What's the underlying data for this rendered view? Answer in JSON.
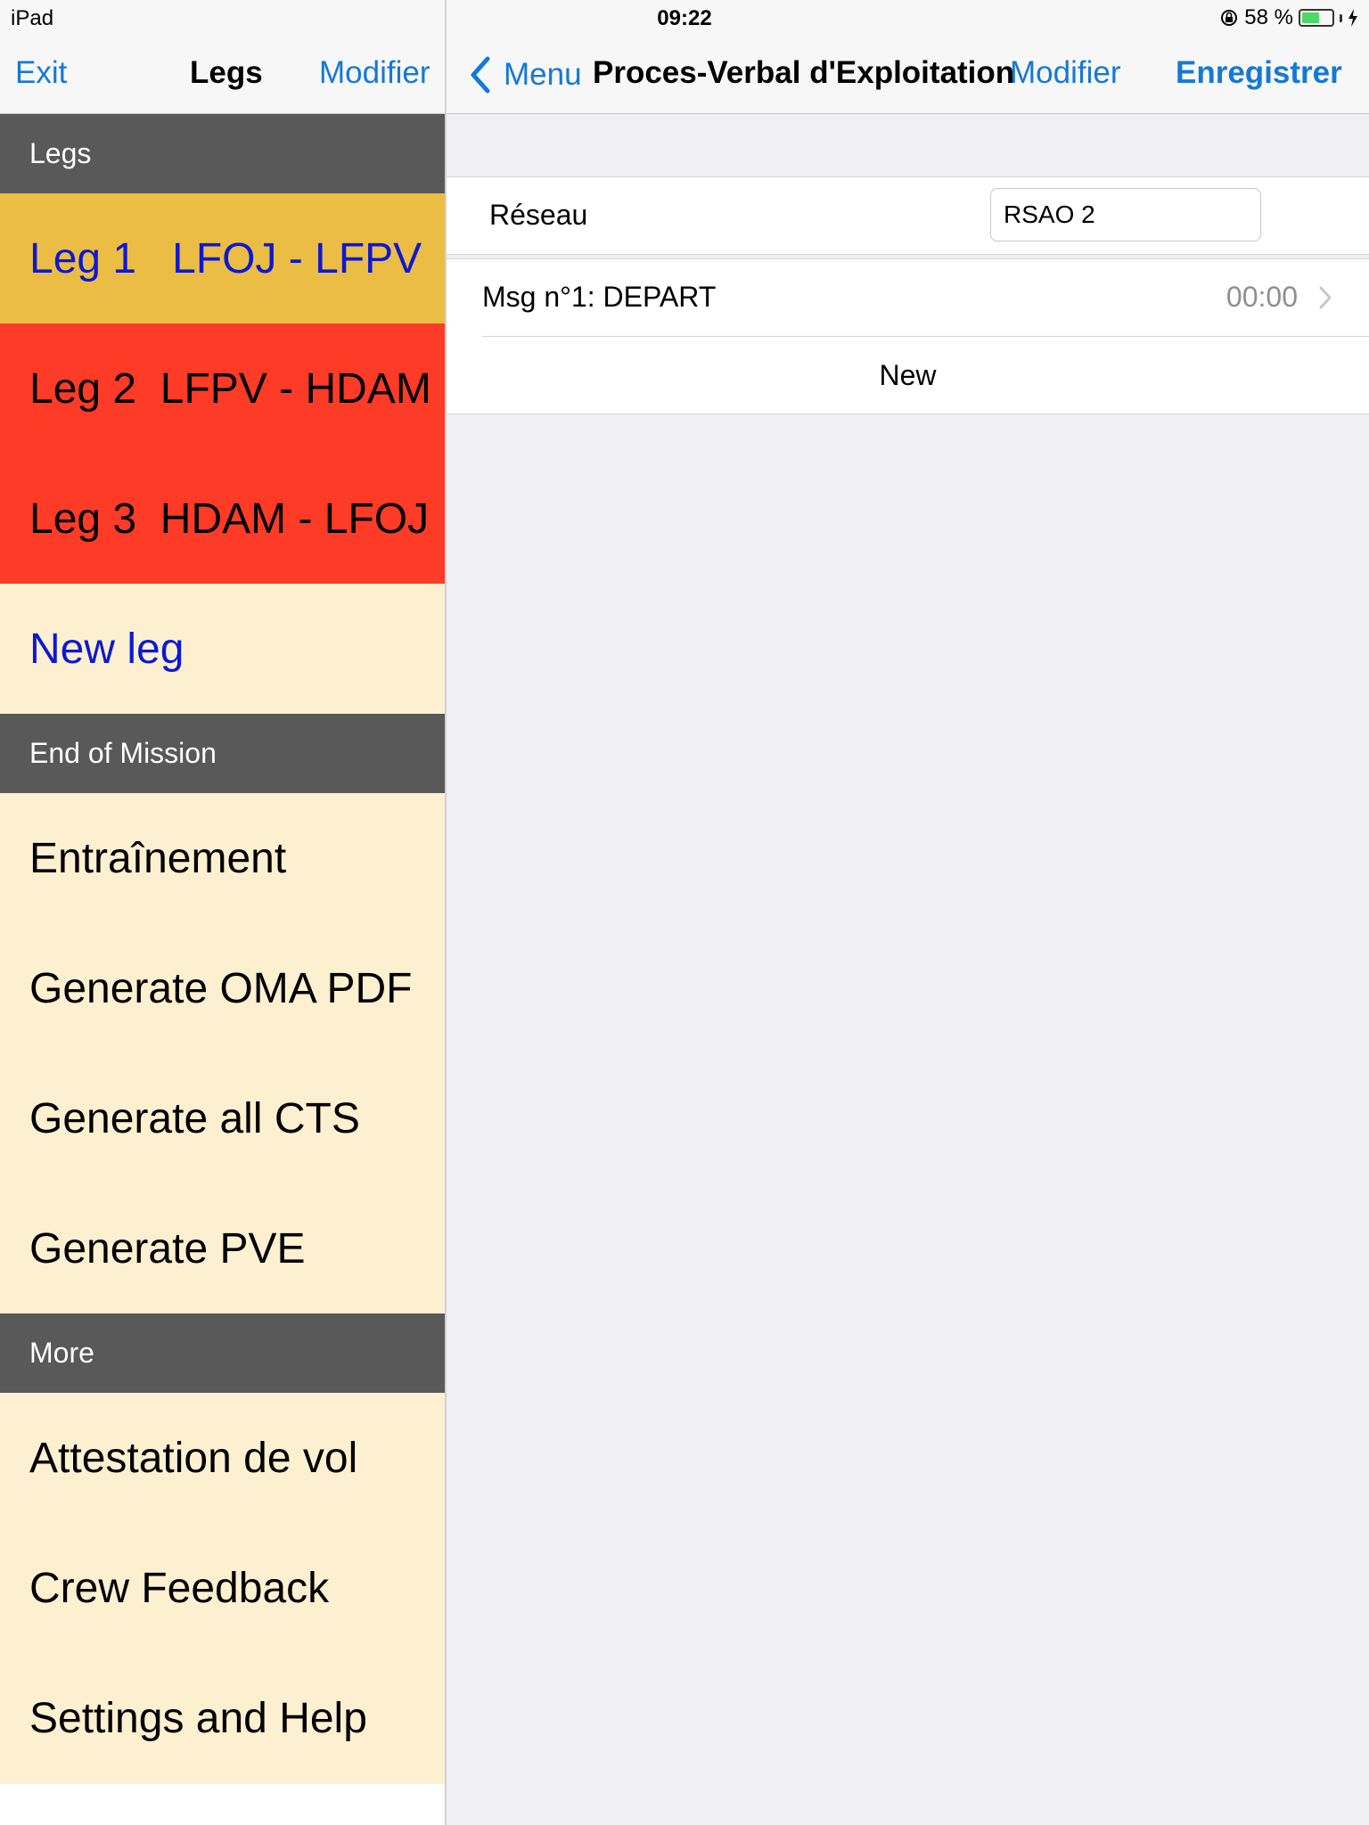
{
  "status_bar": {
    "device": "iPad",
    "time": "09:22",
    "battery": "58 %",
    "battery_level": 0.58
  },
  "left_nav": {
    "exit": "Exit",
    "title": "Legs",
    "modifier": "Modifier"
  },
  "sidebar": {
    "sections": {
      "legs": "Legs",
      "end_of_mission": "End of Mission",
      "more": "More"
    },
    "legs": [
      {
        "label": "Leg 1   LFOJ - LFPV"
      },
      {
        "label": "Leg 2  LFPV - HDAM"
      },
      {
        "label": "Leg 3  HDAM - LFOJ"
      }
    ],
    "new_leg": "New leg",
    "end_of_mission_items": [
      "Entraînement",
      "Generate OMA PDF",
      "Generate all CTS",
      "Generate PVE"
    ],
    "more_items": [
      "Attestation de vol",
      "Crew Feedback",
      "Settings and Help"
    ]
  },
  "right_nav": {
    "back": "Menu",
    "title": "Proces-Verbal d'Exploitation",
    "modifier": "Modifier",
    "save": "Enregistrer"
  },
  "form": {
    "reseau_label": "Réseau",
    "reseau_value": "RSAO 2"
  },
  "messages": [
    {
      "label": "Msg n°1: DEPART",
      "time": "00:00"
    }
  ],
  "new_label": "New",
  "colors": {
    "accent": "#1479d6",
    "section_header": "#595959",
    "cream": "#fdf0d0",
    "leg_active": "#ecbd44",
    "leg_alert": "#fe3b26",
    "leg_text_blue": "#0c19d2"
  }
}
